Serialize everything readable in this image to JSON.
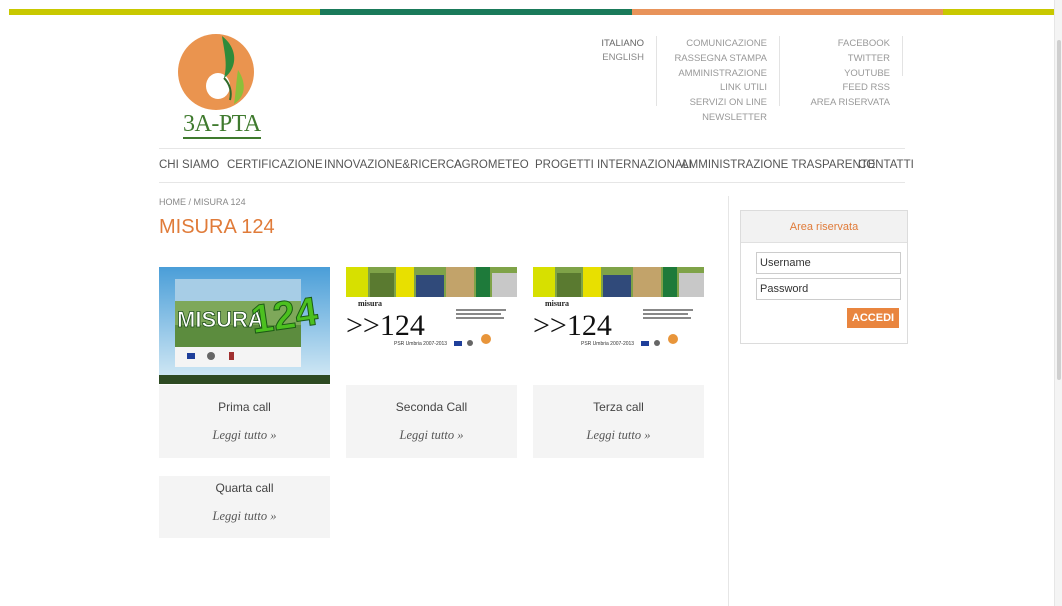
{
  "colors": {
    "orange": "#e07b39",
    "green": "#1a7a5a",
    "lime": "#c8c800",
    "peach": "#e8935a"
  },
  "logo": {
    "text": "3A-PTA",
    "icon": "logo-icon"
  },
  "languages": [
    "ITALIANO",
    "ENGLISH"
  ],
  "util_links": [
    "COMUNICAZIONE",
    "RASSEGNA STAMPA",
    "AMMINISTRAZIONE",
    "LINK UTILI",
    "SERVIZI ON LINE",
    "NEWSLETTER"
  ],
  "social_links": [
    "FACEBOOK",
    "TWITTER",
    "YOUTUBE",
    "FEED RSS",
    "AREA RISERVATA"
  ],
  "nav": [
    "CHI SIAMO",
    "CERTIFICAZIONE",
    "INNOVAZIONE&RICERCA",
    "AGROMETEO",
    "PROGETTI INTERNAZIONALI",
    "AMMINISTRAZIONE TRASPARENTE",
    "CONTATTI"
  ],
  "breadcrumb": {
    "home": "HOME",
    "sep": "/",
    "current": "MISURA 124"
  },
  "page_title": "MISURA 124",
  "cards": [
    {
      "title": "Prima call",
      "read_more": "Leggi tutto »",
      "image": {
        "word": "MISURA",
        "number": "124"
      }
    },
    {
      "title": "Seconda Call",
      "read_more": "Leggi tutto »",
      "image": {
        "small": "misura",
        "number": ">>124",
        "caption": "PSR Umbria 2007-2013"
      }
    },
    {
      "title": "Terza call",
      "read_more": "Leggi tutto »",
      "image": {
        "small": "misura",
        "number": ">>124",
        "caption": "PSR Umbria 2007-2013"
      }
    },
    {
      "title": "Quarta call",
      "read_more": "Leggi tutto »"
    }
  ],
  "login": {
    "title": "Area riservata",
    "username_placeholder": "Username",
    "password_placeholder": "Password",
    "submit": "ACCEDI"
  }
}
